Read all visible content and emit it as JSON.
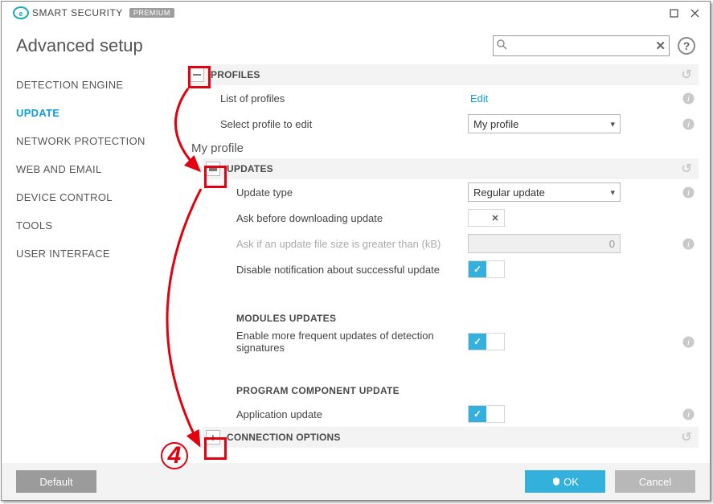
{
  "brand": {
    "name_thin": "SMART",
    "name_bold": "SECURITY",
    "tag": "PREMIUM"
  },
  "window": {
    "page_title": "Advanced setup"
  },
  "search": {
    "value": "",
    "placeholder": ""
  },
  "sidebar": {
    "items": [
      {
        "label": "DETECTION ENGINE"
      },
      {
        "label": "UPDATE"
      },
      {
        "label": "NETWORK PROTECTION"
      },
      {
        "label": "WEB AND EMAIL"
      },
      {
        "label": "DEVICE CONTROL"
      },
      {
        "label": "TOOLS"
      },
      {
        "label": "USER INTERFACE"
      }
    ],
    "active_index": 1
  },
  "sections": {
    "profiles": {
      "title": "PROFILES",
      "list_label": "List of profiles",
      "list_action": "Edit",
      "select_label": "Select profile to edit",
      "select_value": "My profile"
    },
    "profile_name": "My profile",
    "updates": {
      "title": "UPDATES",
      "type_label": "Update type",
      "type_value": "Regular update",
      "ask_label": "Ask before downloading update",
      "ask_value": false,
      "asksize_label": "Ask if an update file size is greater than (kB)",
      "asksize_value": "0",
      "disable_notify_label": "Disable notification about successful update",
      "disable_notify_value": true,
      "modules_head": "MODULES UPDATES",
      "freq_label": "Enable more frequent updates of detection signatures",
      "freq_value": true,
      "pcu_head": "PROGRAM COMPONENT UPDATE",
      "app_label": "Application update",
      "app_value": true
    },
    "conn": {
      "title": "CONNECTION OPTIONS"
    }
  },
  "footer": {
    "default": "Default",
    "ok": "OK",
    "cancel": "Cancel"
  },
  "annotation": {
    "step": "4"
  }
}
